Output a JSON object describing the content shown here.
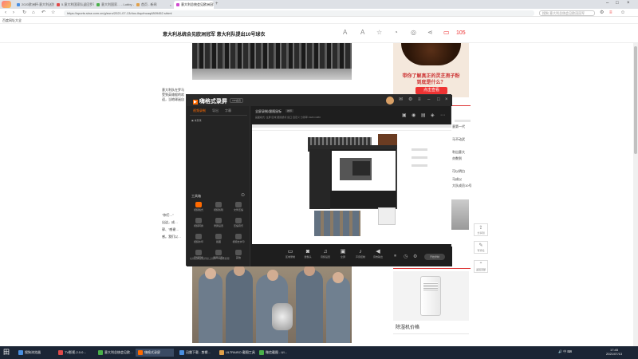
{
  "browser": {
    "tabs": [
      {
        "label": "2020欧洲杯:意大利送别…",
        "color": "#4a8fe0"
      },
      {
        "label": "5.意大利国家队返回罗马",
        "color": "#e04a4a"
      },
      {
        "label": "意大利国家… - Lobby - 主页",
        "color": "#4ab04a"
      },
      {
        "label": "首页 - 新闻",
        "color": "#e0a04a"
      },
      {
        "label": "意大利总统会见欧洲冠军 意…",
        "color": "#d04ad0"
      }
    ],
    "url": "https://sports.sina.com.cn/g/euro/2021-07-13/doc-ikqcfncaq4809452.shtml",
    "search_placeholder": "搜狗 意大利总统会见欧冠冠军",
    "bookmark": "百度网址大全"
  },
  "article": {
    "title": "意大利总统会见欧洲冠军 意大利队提出10号球衣",
    "comment_count": "105",
    "para_left": "意大利队在罗马受到英雄般的欢迎，当地球迷自发组织庆祝活动。\n路透：在罗马…",
    "para_left2": "\"你们…\"\n出这，成…\n郭、\"感谢…\n感。我们以…",
    "right_fragments": [
      "意第一代",
      "马不动武",
      "利出意大",
      "亦数到",
      "可以明白",
      "马成以",
      "大队成员10号"
    ]
  },
  "ads": {
    "coffee_line1": "带你了解真正的灵芝孢子粉",
    "coffee_line2": "到底是什么？",
    "coffee_button": "点击查看",
    "dehumidifier_caption": "除湿机价格"
  },
  "side_buttons": [
    {
      "label": "分享到",
      "icon": "share-icon"
    },
    {
      "label": "写评论",
      "icon": "edit-icon"
    },
    {
      "label": "返回顶部",
      "icon": "top-icon"
    }
  ],
  "recorder": {
    "app_name": "嗨格式录屏",
    "badge": "VIP会员",
    "tabs": [
      "视频录制",
      "导出",
      "字幕"
    ],
    "user_hint": "未登录",
    "tool_header": "工具箱",
    "tools": [
      "视频格式",
      "视频剪辑",
      "文件压缩",
      "视频转换",
      "录屏设置",
      "压缩音乐",
      "视频水印",
      "截图",
      "视频去水印",
      "音频转换",
      "录屏设置2",
      "其他"
    ],
    "footer_note": "在线工具正在持续上线中 — 在线客服",
    "project_label": "全屏录制/跟随鼠标",
    "project_badge": "推荐",
    "info_line": "画面模式: 全屏  区域  跟随鼠标  窗口  自定义  分辨率 1920×1080",
    "bottom_buttons": [
      "区域录制",
      "摄像头",
      "音频设置",
      "全屏",
      "声音控制",
      "音效输出"
    ],
    "start_label": "开始录制"
  },
  "taskbar": {
    "start_label": "田",
    "items": [
      {
        "label": "搜狗浏览器",
        "color": "#4a8fe0"
      },
      {
        "label": "TV影视-2.0.0…",
        "color": "#e04a4a"
      },
      {
        "label": "意大利总统会见欧…",
        "color": "#4ab04a"
      },
      {
        "label": "嗨格式录屏",
        "color": "#ff6a00"
      },
      {
        "label": "迅雷下载 - 剪辑…",
        "color": "#4a8fe0"
      },
      {
        "label": "ULTRAISO 截图工具",
        "color": "#e0a04a"
      },
      {
        "label": "微信截图 - UI…",
        "color": "#4ab04a"
      }
    ],
    "tray": "🔊 中 ⌨",
    "time": "17:45",
    "date": "2021/07/13"
  }
}
